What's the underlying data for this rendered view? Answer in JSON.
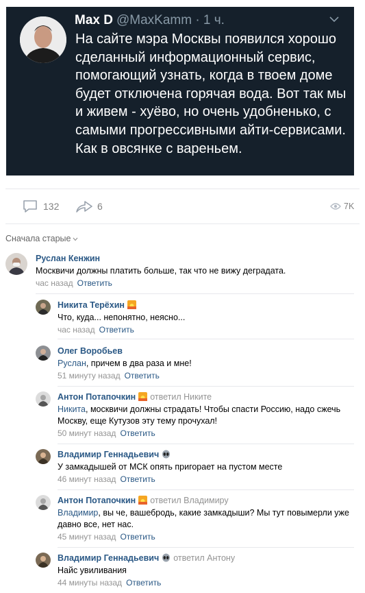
{
  "tweet": {
    "name": "Max D",
    "handle": "@MaxKamm",
    "time": "· 1 ч.",
    "text": "На сайте мэра Москвы появился хорошо сделанный информационный сервис, помогающий узнать, когда в твоем доме будет отключена горячая вода. Вот так мы и живем - хуёво, но очень удобненько, с самыми прогрессивными айти-сервисами. Как в овсянке с вареньем.",
    "colors": {
      "background": "#15202b",
      "muted": "#8899a6"
    }
  },
  "post_actions": {
    "comments_count": "132",
    "shares_count": "6",
    "views_count": "7K"
  },
  "sort": {
    "label": "Сначала старые"
  },
  "comments": [
    {
      "author": "Руслан Кенжин",
      "reply_to": "",
      "addressee": "",
      "text": "Москвичи должны платить больше, так что не вижу деградата.",
      "time": "час назад",
      "reply_label": "Ответить",
      "icon": ""
    },
    {
      "author": "Никита Терёхин",
      "reply_to": "",
      "addressee": "",
      "text": "Что, куда... непонятно, неясно...",
      "time": "час назад",
      "reply_label": "Ответить",
      "icon": "sunset-emoji"
    },
    {
      "author": "Олег Воробьев",
      "reply_to": "",
      "addressee": "Руслан",
      "text": ", причем в два раза и мне!",
      "time": "51 минуту назад",
      "reply_label": "Ответить",
      "icon": ""
    },
    {
      "author": "Антон Потапочкин",
      "reply_to": "ответил Никите",
      "addressee": "Никита",
      "text": ", москвичи должны страдать! Чтобы спасти Россию, надо сжечь Москву, еще Кутузов эту тему прочухал!",
      "time": "50 минут назад",
      "reply_label": "Ответить",
      "icon": "sunset-emoji"
    },
    {
      "author": "Владимир Геннадьевич",
      "reply_to": "",
      "addressee": "",
      "text": "У замкадышей от МСК опять пригорает на пустом месте",
      "time": "46 минут назад",
      "reply_label": "Ответить",
      "icon": "alien-emoji"
    },
    {
      "author": "Антон Потапочкин",
      "reply_to": "ответил Владимиру",
      "addressee": "Владимир",
      "text": ", вы че, вашебродь, какие замкадыши? Мы тут повымерли уже давно все, нет нас.",
      "time": "45 минут назад",
      "reply_label": "Ответить",
      "icon": "sunset-emoji"
    },
    {
      "author": "Владимир Геннадьевич",
      "reply_to": "ответил Антону",
      "addressee": "",
      "text": "Найс увиливания",
      "time": "44 минуты назад",
      "reply_label": "Ответить",
      "icon": "alien-emoji"
    }
  ]
}
